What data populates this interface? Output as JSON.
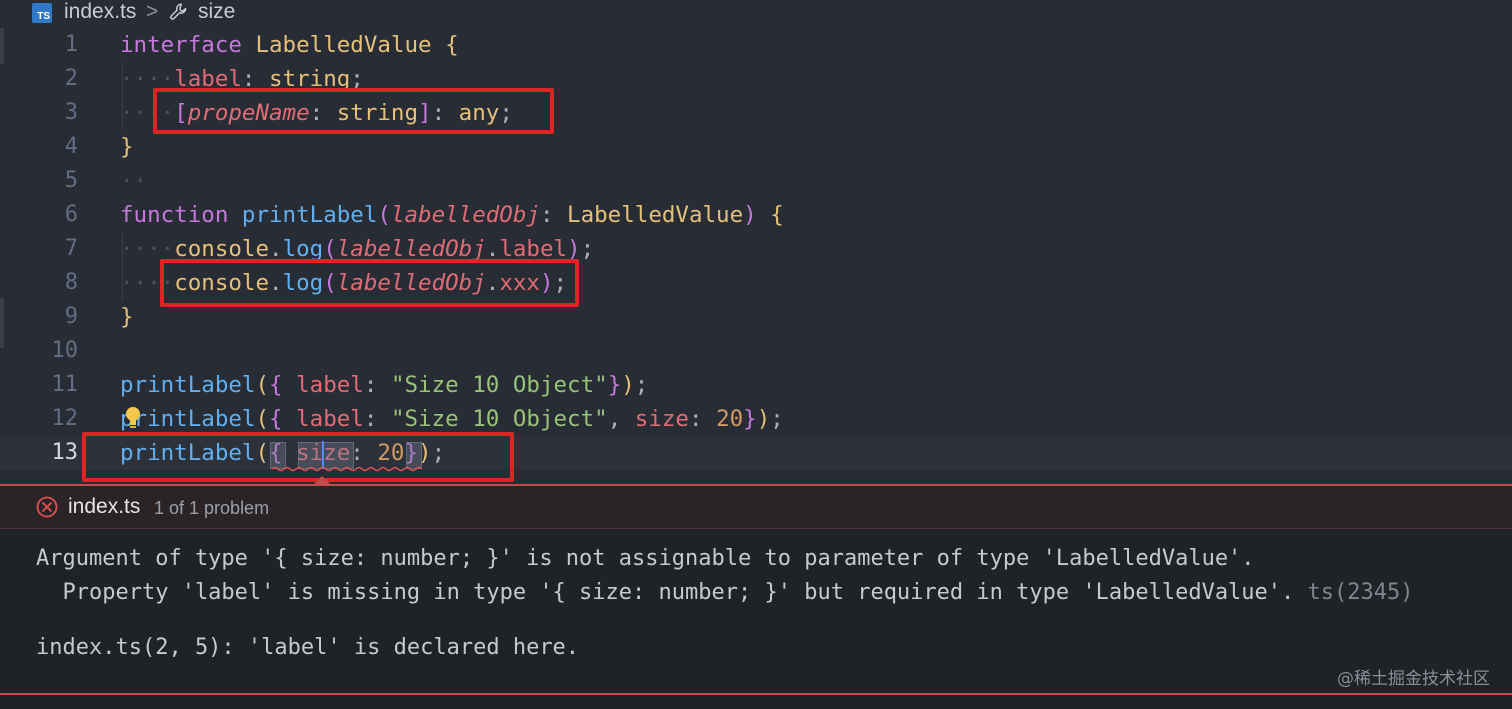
{
  "breadcrumb": {
    "file_badge": "TS",
    "file": "index.ts",
    "separator": ">",
    "symbol": "size"
  },
  "editor": {
    "line_numbers": [
      "1",
      "2",
      "3",
      "4",
      "5",
      "6",
      "7",
      "8",
      "9",
      "10",
      "11",
      "12",
      "13"
    ],
    "current_line": "13",
    "lines": [
      "interface LabelledValue {",
      "    label: string;",
      "    [propeName: string]: any;",
      "}",
      "",
      "function printLabel(labelledObj: LabelledValue) {",
      "    console.log(labelledObj.label);",
      "    console.log(labelledObj.xxx);",
      "}",
      "",
      "printLabel({ label: \"Size 10 Object\"});",
      "printLabel({ label: \"Size 10 Object\", size: 20});",
      "printLabel({ size: 20});"
    ]
  },
  "problems_panel": {
    "file": "index.ts",
    "count": "1 of 1 problem",
    "message_line1": "Argument of type '{ size: number; }' is not assignable to parameter of type 'LabelledValue'.",
    "message_line2": "  Property 'label' is missing in type '{ size: number; }' but required in type 'LabelledValue'.",
    "message_code": " ts(2345)",
    "related": "index.ts(2, 5): 'label' is declared here."
  },
  "watermark": "@稀土掘金技术社区",
  "colors": {
    "keyword": "#c678dd",
    "type": "#e5c07b",
    "function": "#61afef",
    "property": "#e06c75",
    "string": "#98c379",
    "number": "#d19a66",
    "highlight_box": "#e02424",
    "error": "#e05252"
  },
  "icons": [
    "typescript-file-icon",
    "wrench-icon",
    "lightbulb-icon",
    "error-circle-icon"
  ]
}
